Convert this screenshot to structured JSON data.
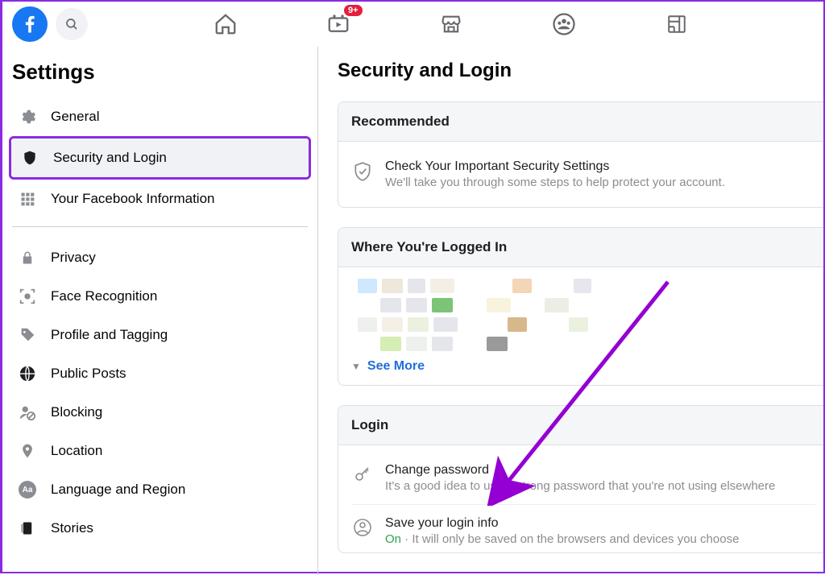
{
  "topbar": {
    "badge": "9+"
  },
  "sidebar": {
    "title": "Settings",
    "items": [
      {
        "label": "General"
      },
      {
        "label": "Security and Login"
      },
      {
        "label": "Your Facebook Information"
      },
      {
        "label": "Privacy"
      },
      {
        "label": "Face Recognition"
      },
      {
        "label": "Profile and Tagging"
      },
      {
        "label": "Public Posts"
      },
      {
        "label": "Blocking"
      },
      {
        "label": "Location"
      },
      {
        "label": "Language and Region"
      },
      {
        "label": "Stories"
      }
    ]
  },
  "page": {
    "title": "Security and Login",
    "recommended": {
      "header": "Recommended",
      "title": "Check Your Important Security Settings",
      "sub": "We'll take you through some steps to help protect your account."
    },
    "sessions": {
      "header": "Where You're Logged In",
      "see_more": "See More"
    },
    "login": {
      "header": "Login",
      "change_pw_title": "Change password",
      "change_pw_sub": "It's a good idea to use a strong password that you're not using elsewhere",
      "save_title": "Save your login info",
      "save_on": "On",
      "save_dot": " · ",
      "save_sub": "It will only be saved on the browsers and devices you choose"
    }
  }
}
